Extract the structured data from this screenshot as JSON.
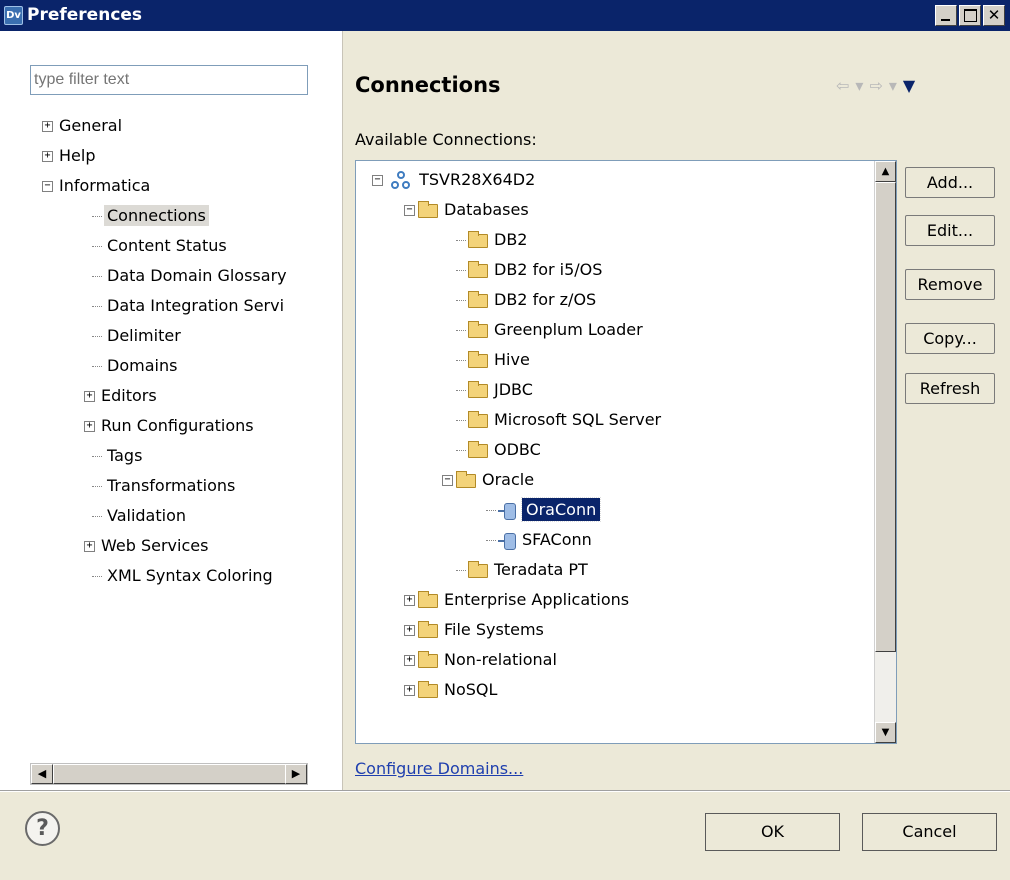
{
  "window": {
    "title": "Preferences",
    "icon_text": "Dv"
  },
  "filter": {
    "placeholder": "type filter text"
  },
  "nav": {
    "items": [
      {
        "label": "General",
        "expander": "+"
      },
      {
        "label": "Help",
        "expander": "+"
      },
      {
        "label": "Informatica",
        "expander": "-"
      },
      {
        "label": "Connections",
        "selected": true
      },
      {
        "label": "Content Status"
      },
      {
        "label": "Data Domain Glossary"
      },
      {
        "label": "Data Integration Servi"
      },
      {
        "label": "Delimiter"
      },
      {
        "label": "Domains"
      },
      {
        "label": "Editors",
        "expander": "+"
      },
      {
        "label": "Run Configurations",
        "expander": "+"
      },
      {
        "label": "Tags"
      },
      {
        "label": "Transformations"
      },
      {
        "label": "Validation"
      },
      {
        "label": "Web Services",
        "expander": "+"
      },
      {
        "label": "XML Syntax Coloring"
      }
    ]
  },
  "main": {
    "title": "Connections",
    "available_label": "Available Connections:",
    "tree": [
      {
        "label": "TSVR28X64D2",
        "icon": "server-icon",
        "expander": "-"
      },
      {
        "label": "Databases",
        "icon": "folder-icon",
        "expander": "-"
      },
      {
        "label": "DB2",
        "icon": "folder-icon"
      },
      {
        "label": "DB2 for i5/OS",
        "icon": "folder-icon"
      },
      {
        "label": "DB2 for z/OS",
        "icon": "folder-icon"
      },
      {
        "label": "Greenplum Loader",
        "icon": "folder-icon"
      },
      {
        "label": "Hive",
        "icon": "folder-icon"
      },
      {
        "label": "JDBC",
        "icon": "folder-icon"
      },
      {
        "label": "Microsoft SQL Server",
        "icon": "folder-icon"
      },
      {
        "label": "ODBC",
        "icon": "folder-icon"
      },
      {
        "label": "Oracle",
        "icon": "folder-icon",
        "expander": "-"
      },
      {
        "label": "OraConn",
        "icon": "connection-icon",
        "selected": true
      },
      {
        "label": "SFAConn",
        "icon": "connection-icon"
      },
      {
        "label": "Teradata PT",
        "icon": "folder-icon"
      },
      {
        "label": "Enterprise Applications",
        "icon": "folder-icon",
        "expander": "+"
      },
      {
        "label": "File Systems",
        "icon": "folder-icon",
        "expander": "+"
      },
      {
        "label": "Non-relational",
        "icon": "folder-icon",
        "expander": "+"
      },
      {
        "label": "NoSQL",
        "icon": "folder-icon",
        "expander": "+"
      }
    ],
    "buttons": {
      "add": "Add...",
      "edit": "Edit...",
      "remove": "Remove",
      "copy": "Copy...",
      "refresh": "Refresh"
    },
    "configure_link": "Configure Domains..."
  },
  "footer": {
    "ok": "OK",
    "cancel": "Cancel",
    "help_glyph": "?"
  }
}
